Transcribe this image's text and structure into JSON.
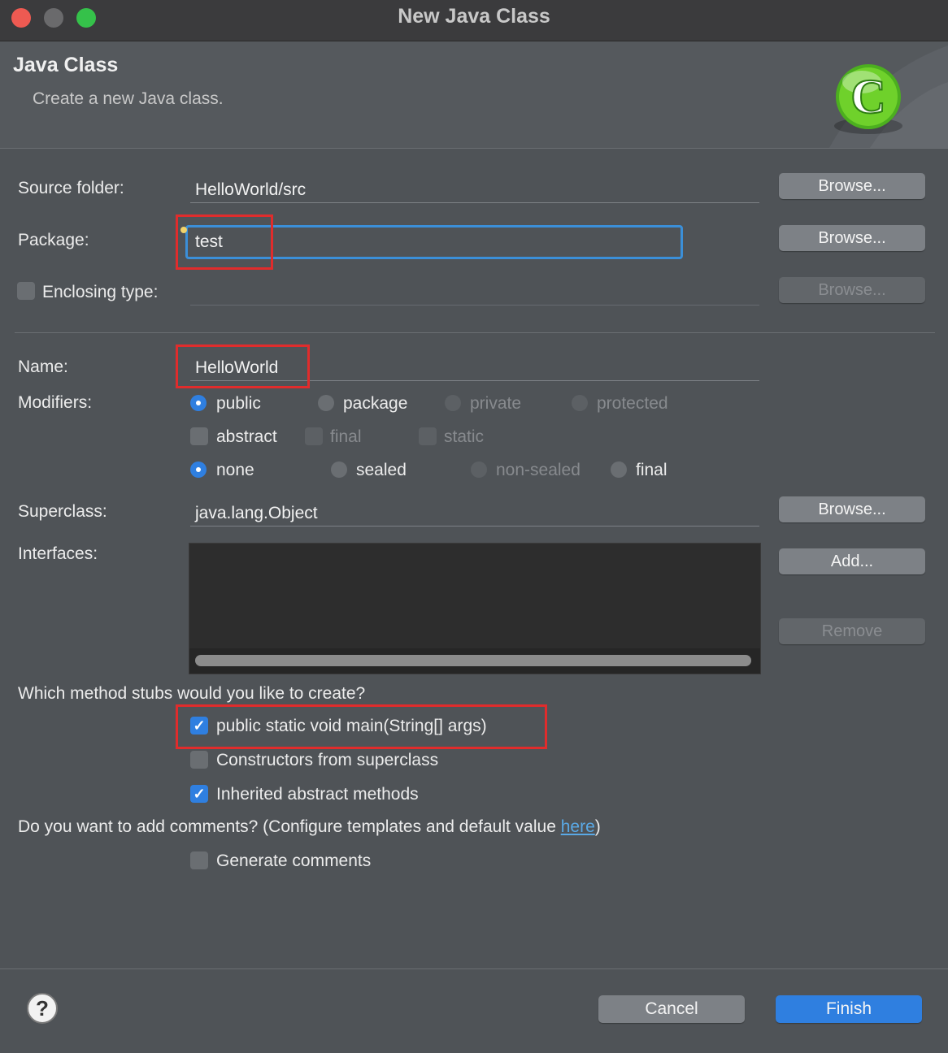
{
  "window": {
    "title": "New Java Class"
  },
  "header": {
    "title": "Java Class",
    "subtitle": "Create a new Java class."
  },
  "source_folder": {
    "label": "Source folder:",
    "value": "HelloWorld/src",
    "browse": "Browse..."
  },
  "package": {
    "label": "Package:",
    "value": "test",
    "browse": "Browse..."
  },
  "enclosing": {
    "label": "Enclosing type:",
    "value": "",
    "browse": "Browse..."
  },
  "name": {
    "label": "Name:",
    "value": "HelloWorld"
  },
  "modifiers": {
    "label": "Modifiers:",
    "access": {
      "public": "public",
      "package": "package",
      "private": "private",
      "protected": "protected",
      "selected": "public"
    },
    "flags": {
      "abstract": "abstract",
      "final": "final",
      "static": "static"
    },
    "seal": {
      "none": "none",
      "sealed": "sealed",
      "non_sealed": "non-sealed",
      "final": "final",
      "selected": "none"
    }
  },
  "superclass": {
    "label": "Superclass:",
    "value": "java.lang.Object",
    "browse": "Browse..."
  },
  "interfaces": {
    "label": "Interfaces:",
    "add": "Add...",
    "remove": "Remove"
  },
  "stubs": {
    "question": "Which method stubs would you like to create?",
    "main": "public static void main(String[] args)",
    "constructors": "Constructors from superclass",
    "inherited": "Inherited abstract methods"
  },
  "comments": {
    "question_prefix": "Do you want to add comments? (Configure templates and default value ",
    "link": "here",
    "question_suffix": ")",
    "generate": "Generate comments"
  },
  "footer": {
    "help": "?",
    "cancel": "Cancel",
    "finish": "Finish"
  },
  "colors": {
    "accent": "#2f7fe0",
    "finish_button": "#2f7fe0",
    "annotation_box": "#e02c2c",
    "focus_ring": "#3b8fd8",
    "link": "#5aa9e6"
  }
}
